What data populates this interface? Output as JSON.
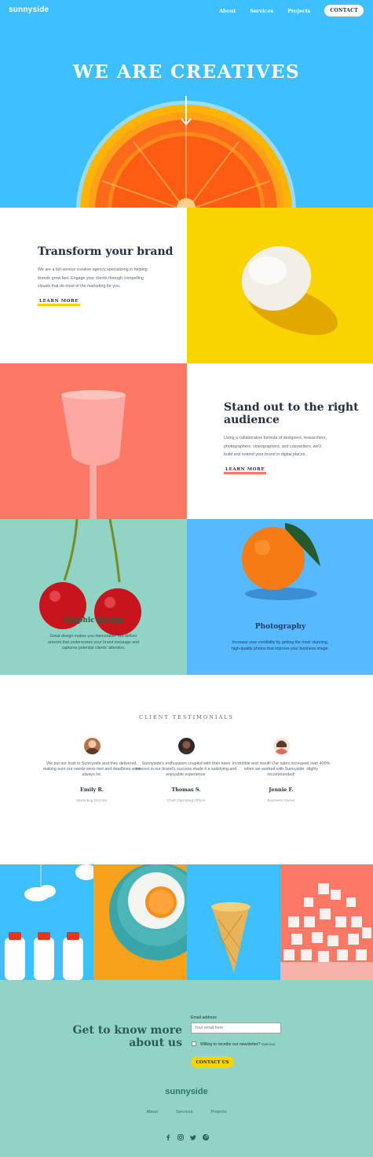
{
  "header": {
    "logo": "sunnyside",
    "nav": [
      "About",
      "Services",
      "Projects"
    ],
    "contact_label": "CONTACT"
  },
  "hero": {
    "title": "WE ARE CREATIVES",
    "icon": "arrow-down-icon"
  },
  "transform": {
    "title": "Transform your brand",
    "body": "We are a full-service creative agency specializing in helping brands grow fast. Engage your clients through compelling visuals that do most of the marketing for you.",
    "link": "LEARN MORE",
    "accent": "#fad400"
  },
  "standout": {
    "title": "Stand out to the right audience",
    "body": "Using a collaborative formula of designers, researchers, photographers, videographers, and copywriters, we'll build and extend your brand in digital places.",
    "link": "LEARN MORE",
    "accent": "#fe7866"
  },
  "services": [
    {
      "title": "Graphic design",
      "body": "Great design makes you memorable. We deliver artwork that underscores your brand message and captures potential clients' attention.",
      "color": "#90d4c5"
    },
    {
      "title": "Photography",
      "body": "Increase your credibility by getting the most stunning, high-quality photos that improve your business image.",
      "color": "#57b9ff"
    }
  ],
  "testimonials": {
    "heading": "CLIENT TESTIMONIALS",
    "items": [
      {
        "quote": "We put our trust in Sunnyside and they delivered, making sure our needs were met and deadlines were always hit.",
        "name": "Emily R.",
        "role": "Marketing Director"
      },
      {
        "quote": "Sunnyside's enthusiasm coupled with their keen interest in our brand's success made it a satisfying and enjoyable experience.",
        "name": "Thomas S.",
        "role": "Chief Operating Officer"
      },
      {
        "quote": "Incredible end result! Our sales increased over 400% when we worked with Sunnyside. Highly recommended!",
        "name": "Jennie F.",
        "role": "Business Owner"
      }
    ]
  },
  "newsletter": {
    "title": "Get to know more about us",
    "email_label": "Email address",
    "email_placeholder": "Your email here",
    "checkbox_label": "Willing to receibe our newsletter?",
    "optional": "Optional",
    "button": "CONTACT US"
  },
  "footer": {
    "logo": "sunnyside",
    "nav": [
      "About",
      "Services",
      "Projects"
    ],
    "social_icons": [
      "facebook-icon",
      "instagram-icon",
      "twitter-icon",
      "pinterest-icon"
    ]
  }
}
